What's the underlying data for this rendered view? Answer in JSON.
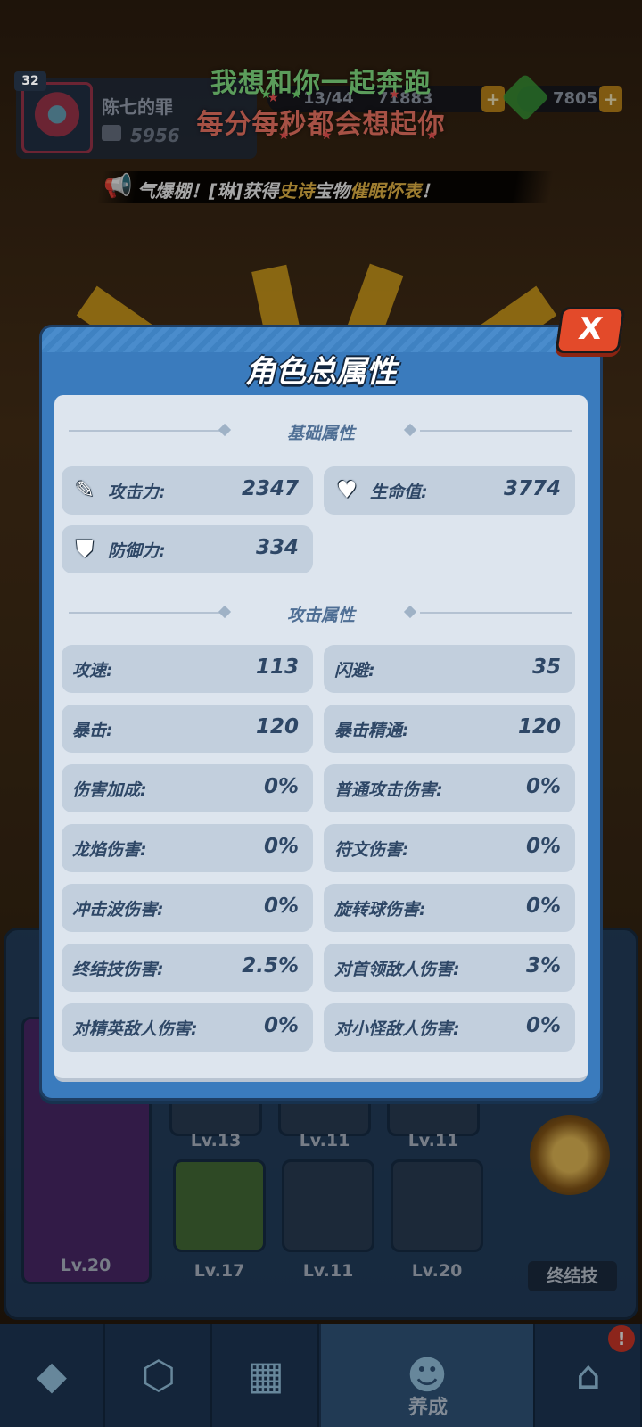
{
  "overlay": {
    "lyric_line1": "我想和你一起奔跑",
    "lyric_line2": "每分每秒都会想起你"
  },
  "hud": {
    "level": "32",
    "player_name": "陈七的罪",
    "power": "5956",
    "resource1": "13/44",
    "resource2": "71883",
    "gems": "7805",
    "plus": "+"
  },
  "ticker": {
    "prefix": "气爆棚！[琳]获得",
    "rarity": "史诗",
    "middle": "宝物",
    "item": "催眠怀表",
    "suffix": "！"
  },
  "modal": {
    "title": "角色总属性",
    "close_label": "X",
    "basic_section": "基础属性",
    "attack_section": "攻击属性",
    "basic_stats": [
      {
        "label": "攻击力:",
        "value": "2347",
        "icon": "sword-icon"
      },
      {
        "label": "生命值:",
        "value": "3774",
        "icon": "heart-icon"
      },
      {
        "label": "防御力:",
        "value": "334",
        "icon": "shield-icon"
      }
    ],
    "attack_stats": [
      {
        "label": "攻速:",
        "value": "113"
      },
      {
        "label": "闪避:",
        "value": "35"
      },
      {
        "label": "暴击:",
        "value": "120"
      },
      {
        "label": "暴击精通:",
        "value": "120"
      },
      {
        "label": "伤害加成:",
        "value": "0%"
      },
      {
        "label": "普通攻击伤害:",
        "value": "0%"
      },
      {
        "label": "龙焰伤害:",
        "value": "0%"
      },
      {
        "label": "符文伤害:",
        "value": "0%"
      },
      {
        "label": "冲击波伤害:",
        "value": "0%"
      },
      {
        "label": "旋转球伤害:",
        "value": "0%"
      },
      {
        "label": "终结技伤害:",
        "value": "2.5%"
      },
      {
        "label": "对首领敌人伤害:",
        "value": "3%"
      },
      {
        "label": "对精英敌人伤害:",
        "value": "0%"
      },
      {
        "label": "对小怪敌人伤害:",
        "value": "0%"
      }
    ]
  },
  "equipment": {
    "weapon_level": "Lv.20",
    "row1_levels": [
      "Lv.13",
      "Lv.11",
      "Lv.11"
    ],
    "row2_levels": [
      "Lv.17",
      "Lv.11",
      "Lv.20"
    ],
    "skill_label": "终结技"
  },
  "nav": {
    "active_label": "养成",
    "alert": "!"
  }
}
